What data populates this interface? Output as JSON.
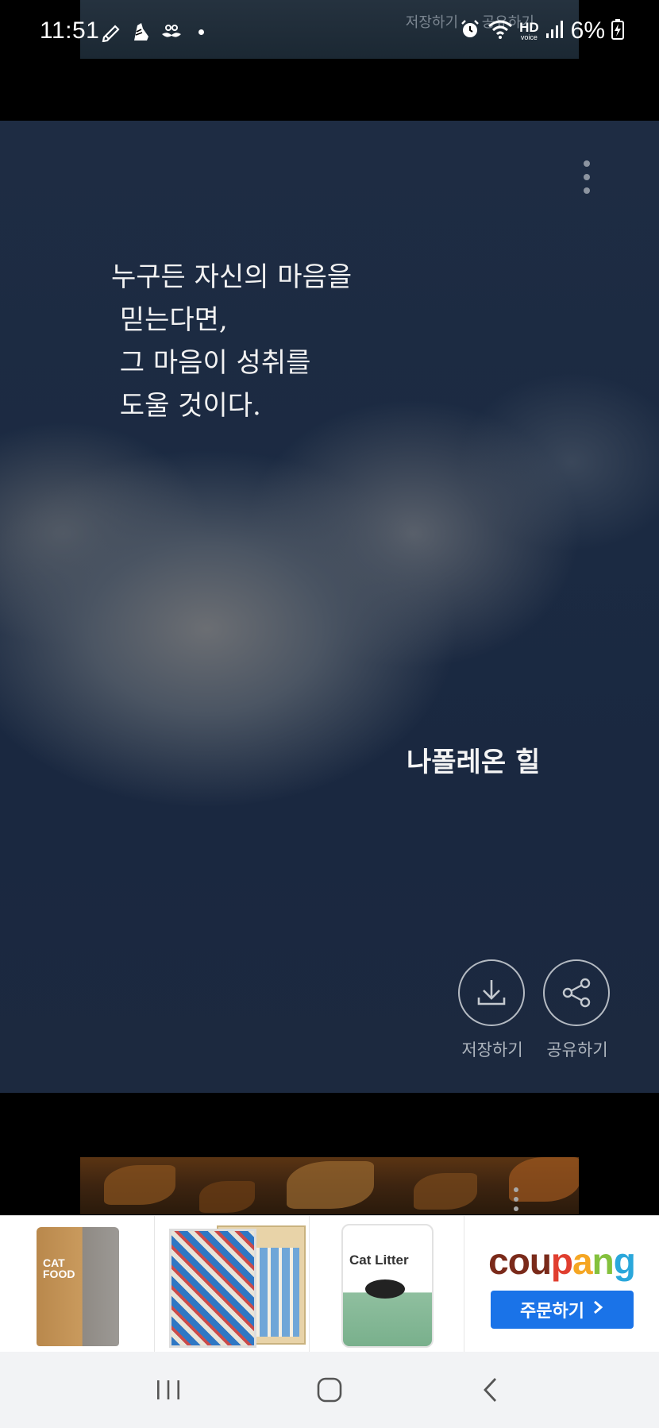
{
  "status_bar": {
    "time": "11:51",
    "battery_percent": "6%",
    "network_label": "HD",
    "network_sublabel": "voice",
    "icons": [
      "pen-icon",
      "shoe-icon",
      "mustache-icon",
      "dot-icon",
      "alarm-icon",
      "wifi-icon",
      "signal-icon",
      "battery-charging-icon"
    ]
  },
  "previous_card": {
    "save_label": "저장하기",
    "share_label": "공유하기"
  },
  "quote_card": {
    "quote_text": "누구든 자신의 마음을\n 믿는다면,\n 그 마음이 성취를\n 도울 것이다.",
    "author": "나폴레온 힐",
    "save_label": "저장하기",
    "share_label": "공유하기",
    "menu_icon": "more-vertical-icon"
  },
  "ad_banner": {
    "products": [
      {
        "name": "cat-food-bag",
        "label_text": "CAT FOOD"
      },
      {
        "name": "cat-calendar"
      },
      {
        "name": "cat-litter",
        "label_text": "Cat Litter"
      }
    ],
    "brand_parts": [
      "cou",
      "p",
      "a",
      "n",
      "g"
    ],
    "cta_label": "주문하기",
    "cta_color": "#1a73e8"
  },
  "navigation": {
    "recent_icon": "recent-apps-icon",
    "home_icon": "home-icon",
    "back_icon": "back-icon"
  }
}
